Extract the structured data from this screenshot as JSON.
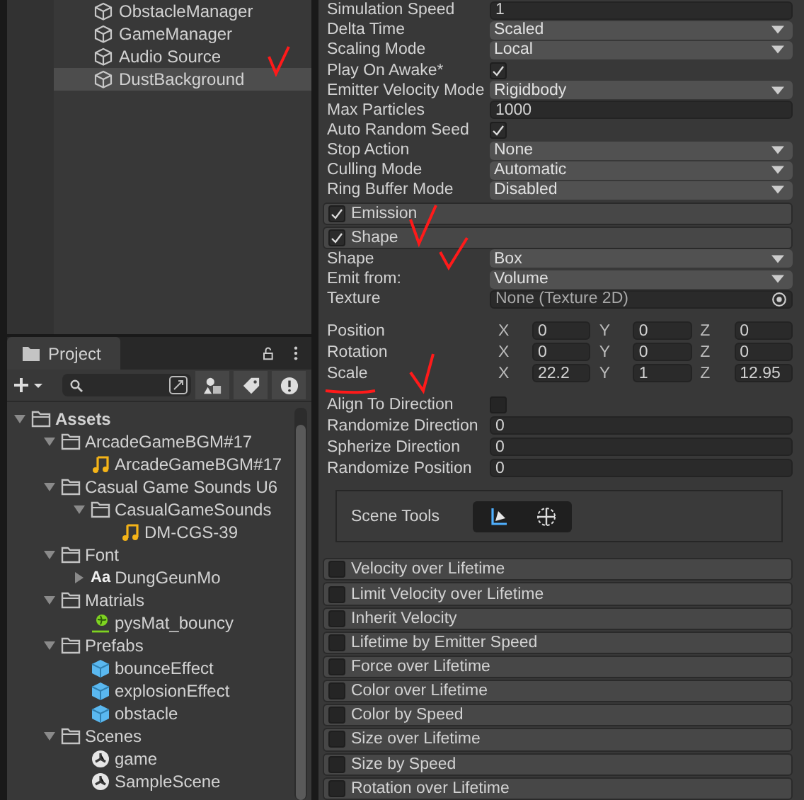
{
  "hierarchy": {
    "items": [
      {
        "name": "ObstacleManager",
        "selected": false
      },
      {
        "name": "GameManager",
        "selected": false
      },
      {
        "name": "Audio Source",
        "selected": false
      },
      {
        "name": "DustBackground",
        "selected": true
      }
    ]
  },
  "project": {
    "tab": "Project",
    "tree": [
      {
        "name": "Assets",
        "kind": "folder",
        "expanded": true,
        "bold": true,
        "children": [
          {
            "name": "ArcadeGameBGM#17",
            "kind": "folder",
            "expanded": true,
            "children": [
              {
                "name": "ArcadeGameBGM#17",
                "kind": "audio"
              }
            ]
          },
          {
            "name": "Casual Game Sounds U6",
            "kind": "folder",
            "expanded": true,
            "children": [
              {
                "name": "CasualGameSounds",
                "kind": "folder",
                "expanded": true,
                "children": [
                  {
                    "name": "DM-CGS-39",
                    "kind": "audio"
                  }
                ]
              }
            ]
          },
          {
            "name": "Font",
            "kind": "folder",
            "expanded": true,
            "children": [
              {
                "name": "DungGeunMo",
                "kind": "font",
                "badge": "Aa",
                "expanded": false
              }
            ]
          },
          {
            "name": "Matrials",
            "kind": "folder",
            "expanded": true,
            "children": [
              {
                "name": "pysMat_bouncy",
                "kind": "material"
              }
            ]
          },
          {
            "name": "Prefabs",
            "kind": "folder",
            "expanded": true,
            "children": [
              {
                "name": "bounceEffect",
                "kind": "prefab"
              },
              {
                "name": "explosionEffect",
                "kind": "prefab"
              },
              {
                "name": "obstacle",
                "kind": "prefab"
              }
            ]
          },
          {
            "name": "Scenes",
            "kind": "folder",
            "expanded": true,
            "children": [
              {
                "name": "game",
                "kind": "scene"
              },
              {
                "name": "SampleScene",
                "kind": "scene"
              }
            ]
          }
        ]
      }
    ]
  },
  "inspector": {
    "main_properties": [
      {
        "label": "Simulation Speed",
        "kind": "number",
        "value": "1"
      },
      {
        "label": "Delta Time",
        "kind": "dropdown",
        "value": "Scaled"
      },
      {
        "label": "Scaling Mode",
        "kind": "dropdown",
        "value": "Local"
      },
      {
        "label": "Play On Awake*",
        "kind": "checkbox",
        "checked": true
      },
      {
        "label": "Emitter Velocity Mode",
        "kind": "dropdown",
        "value": "Rigidbody"
      },
      {
        "label": "Max Particles",
        "kind": "number",
        "value": "1000"
      },
      {
        "label": "Auto Random Seed",
        "kind": "checkbox",
        "checked": true
      },
      {
        "label": "Stop Action",
        "kind": "dropdown",
        "value": "None"
      },
      {
        "label": "Culling Mode",
        "kind": "dropdown",
        "value": "Automatic"
      },
      {
        "label": "Ring Buffer Mode",
        "kind": "dropdown",
        "value": "Disabled"
      }
    ],
    "open_modules": [
      {
        "label": "Emission",
        "checked": true
      },
      {
        "label": "Shape",
        "checked": true
      }
    ],
    "shape_properties": [
      {
        "label": "Shape",
        "kind": "dropdown",
        "value": "Box"
      },
      {
        "label": "Emit from:",
        "kind": "dropdown",
        "value": "Volume"
      },
      {
        "label": "Texture",
        "kind": "object",
        "value": "None (Texture 2D)"
      }
    ],
    "vectors": [
      {
        "label": "Position",
        "axes": [
          {
            "axis": "X",
            "value": "0"
          },
          {
            "axis": "Y",
            "value": "0"
          },
          {
            "axis": "Z",
            "value": "0"
          }
        ]
      },
      {
        "label": "Rotation",
        "axes": [
          {
            "axis": "X",
            "value": "0"
          },
          {
            "axis": "Y",
            "value": "0"
          },
          {
            "axis": "Z",
            "value": "0"
          }
        ]
      },
      {
        "label": "Scale",
        "axes": [
          {
            "axis": "X",
            "value": "22.2"
          },
          {
            "axis": "Y",
            "value": "1"
          },
          {
            "axis": "Z",
            "value": "12.95"
          }
        ]
      }
    ],
    "direction_properties": [
      {
        "label": "Align To Direction",
        "kind": "checkbox",
        "checked": false
      },
      {
        "label": "Randomize Direction",
        "kind": "number",
        "value": "0"
      },
      {
        "label": "Spherize Direction",
        "kind": "number",
        "value": "0"
      },
      {
        "label": "Randomize Position",
        "kind": "number",
        "value": "0"
      }
    ],
    "scene_tools": {
      "label": "Scene Tools"
    },
    "modules": [
      {
        "label": "Velocity over Lifetime",
        "checked": false
      },
      {
        "label": "Limit Velocity over Lifetime",
        "checked": false
      },
      {
        "label": "Inherit Velocity",
        "checked": false
      },
      {
        "label": "Lifetime by Emitter Speed",
        "checked": false
      },
      {
        "label": "Force over Lifetime",
        "checked": false
      },
      {
        "label": "Color over Lifetime",
        "checked": false
      },
      {
        "label": "Color by Speed",
        "checked": false
      },
      {
        "label": "Size over Lifetime",
        "checked": false
      },
      {
        "label": "Size by Speed",
        "checked": false
      },
      {
        "label": "Rotation over Lifetime",
        "checked": false
      }
    ]
  }
}
